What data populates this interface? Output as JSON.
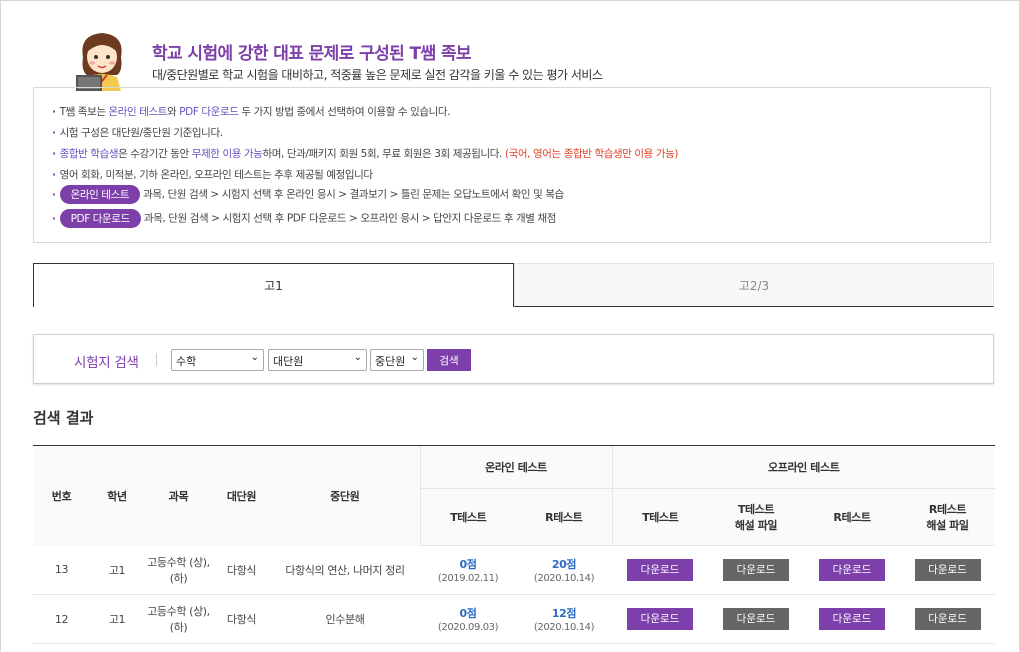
{
  "header": {
    "title": "학교 시험에 강한 대표 문제로 구성된 T쌤 족보",
    "subtitle": "대/중단원별로 학교 시험을 대비하고, 적중률 높은 문제로 실전 감각을 키울 수 있는 평가 서비스"
  },
  "info": {
    "line1": {
      "a": "T쌤 족보는 ",
      "b": "온라인 테스트",
      "c": "와 ",
      "d": "PDF 다운로드",
      "e": " 두 가지 방법 중에서 선택하여 이용할 수 있습니다."
    },
    "line2": "시험 구성은 대단원/중단원 기준입니다.",
    "line3": {
      "a": "종합반 학습생",
      "b": "은 수강기간 동안 ",
      "c": "무제한 이용 가능",
      "d": "하며, 단과/패키지 회원 5회, 무료 회원은 3회 제공됩니다. ",
      "e": "(국어, 영어는 종합반 학습생만 이용 가능)"
    },
    "line4": "영어 회화, 미적분, 기하 온라인, 오프라인 테스트는 추후 제공될 예정입니다",
    "line5": {
      "pill": "온라인 테스트",
      "text": "과목, 단원 검색 > 시험지 선택 후 온라인 응시 > 결과보기 > 틀린 문제는 오답노트에서 확인 및 복습"
    },
    "line6": {
      "pill": "PDF 다운로드",
      "text": "과목, 단원 검색 > 시험지 선택 후 PDF 다운로드 > 오프라인 응시 > 답안지 다운로드 후 개별 채점"
    }
  },
  "tabs": [
    {
      "label": "고1"
    },
    {
      "label": "고2/3"
    }
  ],
  "search": {
    "label": "시험지 검색",
    "subject": "수학",
    "unit_major": "대단원",
    "unit_minor": "중단원",
    "button": "검색"
  },
  "results": {
    "title": "검색 결과",
    "headers": {
      "no": "번호",
      "grade": "학년",
      "subject": "과목",
      "major": "대단원",
      "minor": "중단원",
      "online": "온라인 테스트",
      "offline": "오프라인 테스트",
      "t_test": "T테스트",
      "r_test": "R테스트",
      "t_sol_1": "T테스트",
      "t_sol_2": "해설 파일",
      "r_sol_1": "R테스트",
      "r_sol_2": "해설 파일"
    },
    "download_label": "다운로드",
    "rows": [
      {
        "no": "13",
        "grade": "고1",
        "subject1": "고등수학 (상),",
        "subject2": "(하)",
        "major": "다항식",
        "minor": "다항식의 연산, 나머지 정리",
        "t_score": "0점",
        "t_date": "(2019.02.11)",
        "r_score": "20점",
        "r_date": "(2020.10.14)"
      },
      {
        "no": "12",
        "grade": "고1",
        "subject1": "고등수학 (상),",
        "subject2": "(하)",
        "major": "다항식",
        "minor": "인수분해",
        "t_score": "0점",
        "t_date": "(2020.09.03)",
        "r_score": "12점",
        "r_date": "(2020.10.14)"
      }
    ]
  },
  "colors": {
    "accent": "#7d3fa9",
    "score": "#2c6cc4",
    "warn": "#e0402a",
    "gray_button": "#666666"
  }
}
